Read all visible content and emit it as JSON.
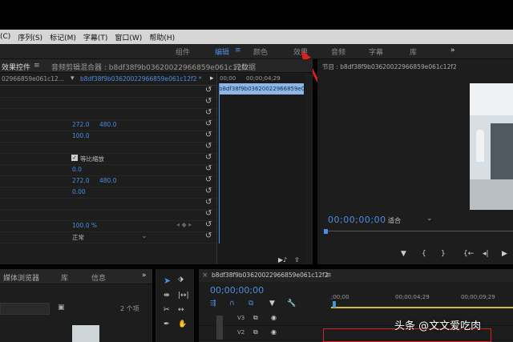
{
  "menu": [
    "(C)",
    "序列(S)",
    "标记(M)",
    "字幕(T)",
    "窗口(W)",
    "帮助(H)"
  ],
  "workspaces": {
    "items": [
      "组件",
      "编辑",
      "颜色",
      "效果",
      "音频",
      "字幕",
      "库"
    ],
    "active": "编辑",
    "more": "»"
  },
  "effect_controls": {
    "tab_active": "效果控件",
    "tab_mixer": "音频剪辑混合器 : b8df38f9b03620022966859e061c12f2",
    "tab_meta": "元数据",
    "source": "02966859e061c12...",
    "clip_label": "b8df38f9b03620022966859e061c12f2 *",
    "time_start": "00;00",
    "time_end": "00;00;04;29",
    "clip_bar": "b8df38f9b03620022966859e0",
    "position_x": "272.0",
    "position_y": "480.0",
    "scale": "100.0",
    "uniform_scale": "等比缩放",
    "rotation": "0.0",
    "anchor_x": "272.0",
    "anchor_y": "480.0",
    "flicker": "0.00",
    "opacity": "100.0 %",
    "blend_mode": "正常"
  },
  "program": {
    "title": "节目 : b8df38f9b03620022966859e061c12f2",
    "timecode": "00;00;00;00",
    "fit": "适合"
  },
  "project": {
    "tab_media": "媒体浏览器",
    "tab_lib": "库",
    "tab_info": "信息",
    "count": "2 个项"
  },
  "timeline": {
    "tab": "b8df38f9b03620022966859e061c12f2",
    "timecode": "00;00;00;00",
    "ruler": [
      ";00;00",
      "00;00;04;29",
      "00;00;09;29"
    ],
    "tracks": [
      "V3",
      "V2"
    ]
  },
  "watermark": "头条 @文文爱吃肉",
  "colors": {
    "accent": "#4a8fe0",
    "annotation": "#e02020",
    "playhead": "#4a8fe0"
  }
}
